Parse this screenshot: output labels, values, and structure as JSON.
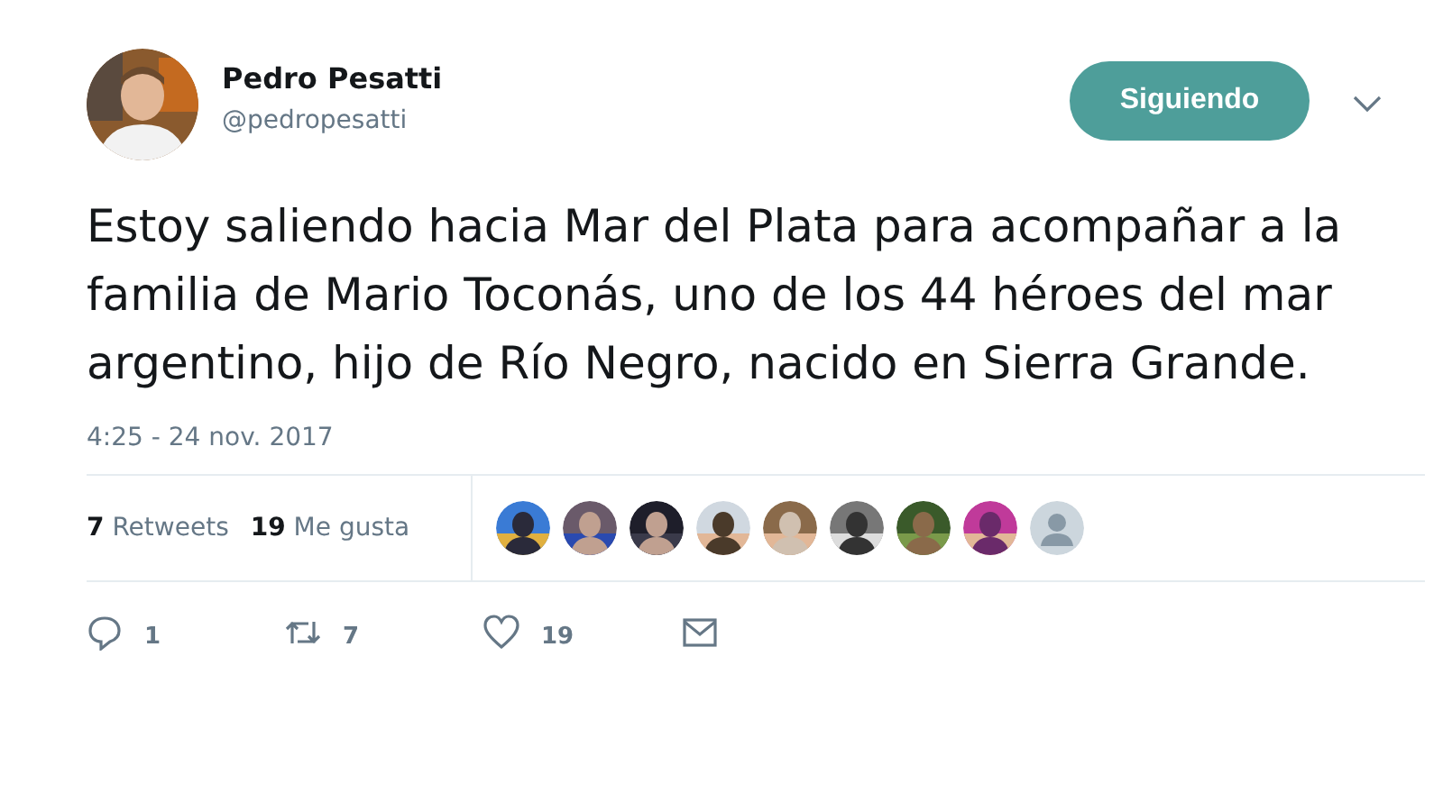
{
  "author": {
    "name": "Pedro Pesatti",
    "handle": "@pedropesatti"
  },
  "follow_button": {
    "label": "Siguiendo"
  },
  "tweet": {
    "text": "Estoy saliendo hacia Mar del Plata para acompañar a la familia de Mario Toconás, uno de los 44 héroes del mar argentino, hijo de Río Negro, nacido en Sierra Grande.",
    "timestamp": "4:25 - 24 nov. 2017"
  },
  "stats": [
    {
      "count": "7",
      "label": "Retweets"
    },
    {
      "count": "19",
      "label": "Me gusta"
    }
  ],
  "likers": [
    {
      "kind": "picture"
    },
    {
      "kind": "picture"
    },
    {
      "kind": "picture"
    },
    {
      "kind": "picture"
    },
    {
      "kind": "picture"
    },
    {
      "kind": "picture"
    },
    {
      "kind": "picture"
    },
    {
      "kind": "picture"
    },
    {
      "kind": "default"
    }
  ],
  "actions": [
    {
      "kind": "reply",
      "count": "1"
    },
    {
      "kind": "retweet",
      "count": "7"
    },
    {
      "kind": "like",
      "count": "19"
    },
    {
      "kind": "message"
    }
  ]
}
